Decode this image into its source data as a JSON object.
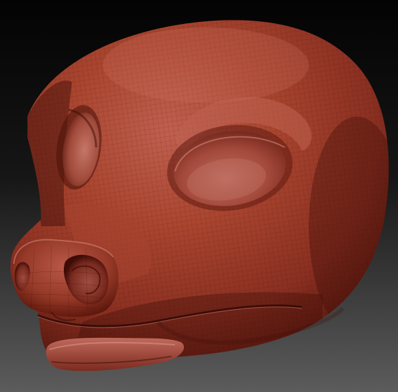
{
  "scene": {
    "subject": "sculpted-creature-head",
    "material": "matcap-red-wax",
    "wireframe_overlay": true
  },
  "colors": {
    "background_top": "#050505",
    "background_bottom": "#5a5a5a",
    "skin_highlight": "#c4604f",
    "skin_base": "#a4402f",
    "skin_mid": "#8b3022",
    "skin_shadow": "#4e140d",
    "rim_light": "#d98a7c",
    "wire": "#2a0a06"
  }
}
